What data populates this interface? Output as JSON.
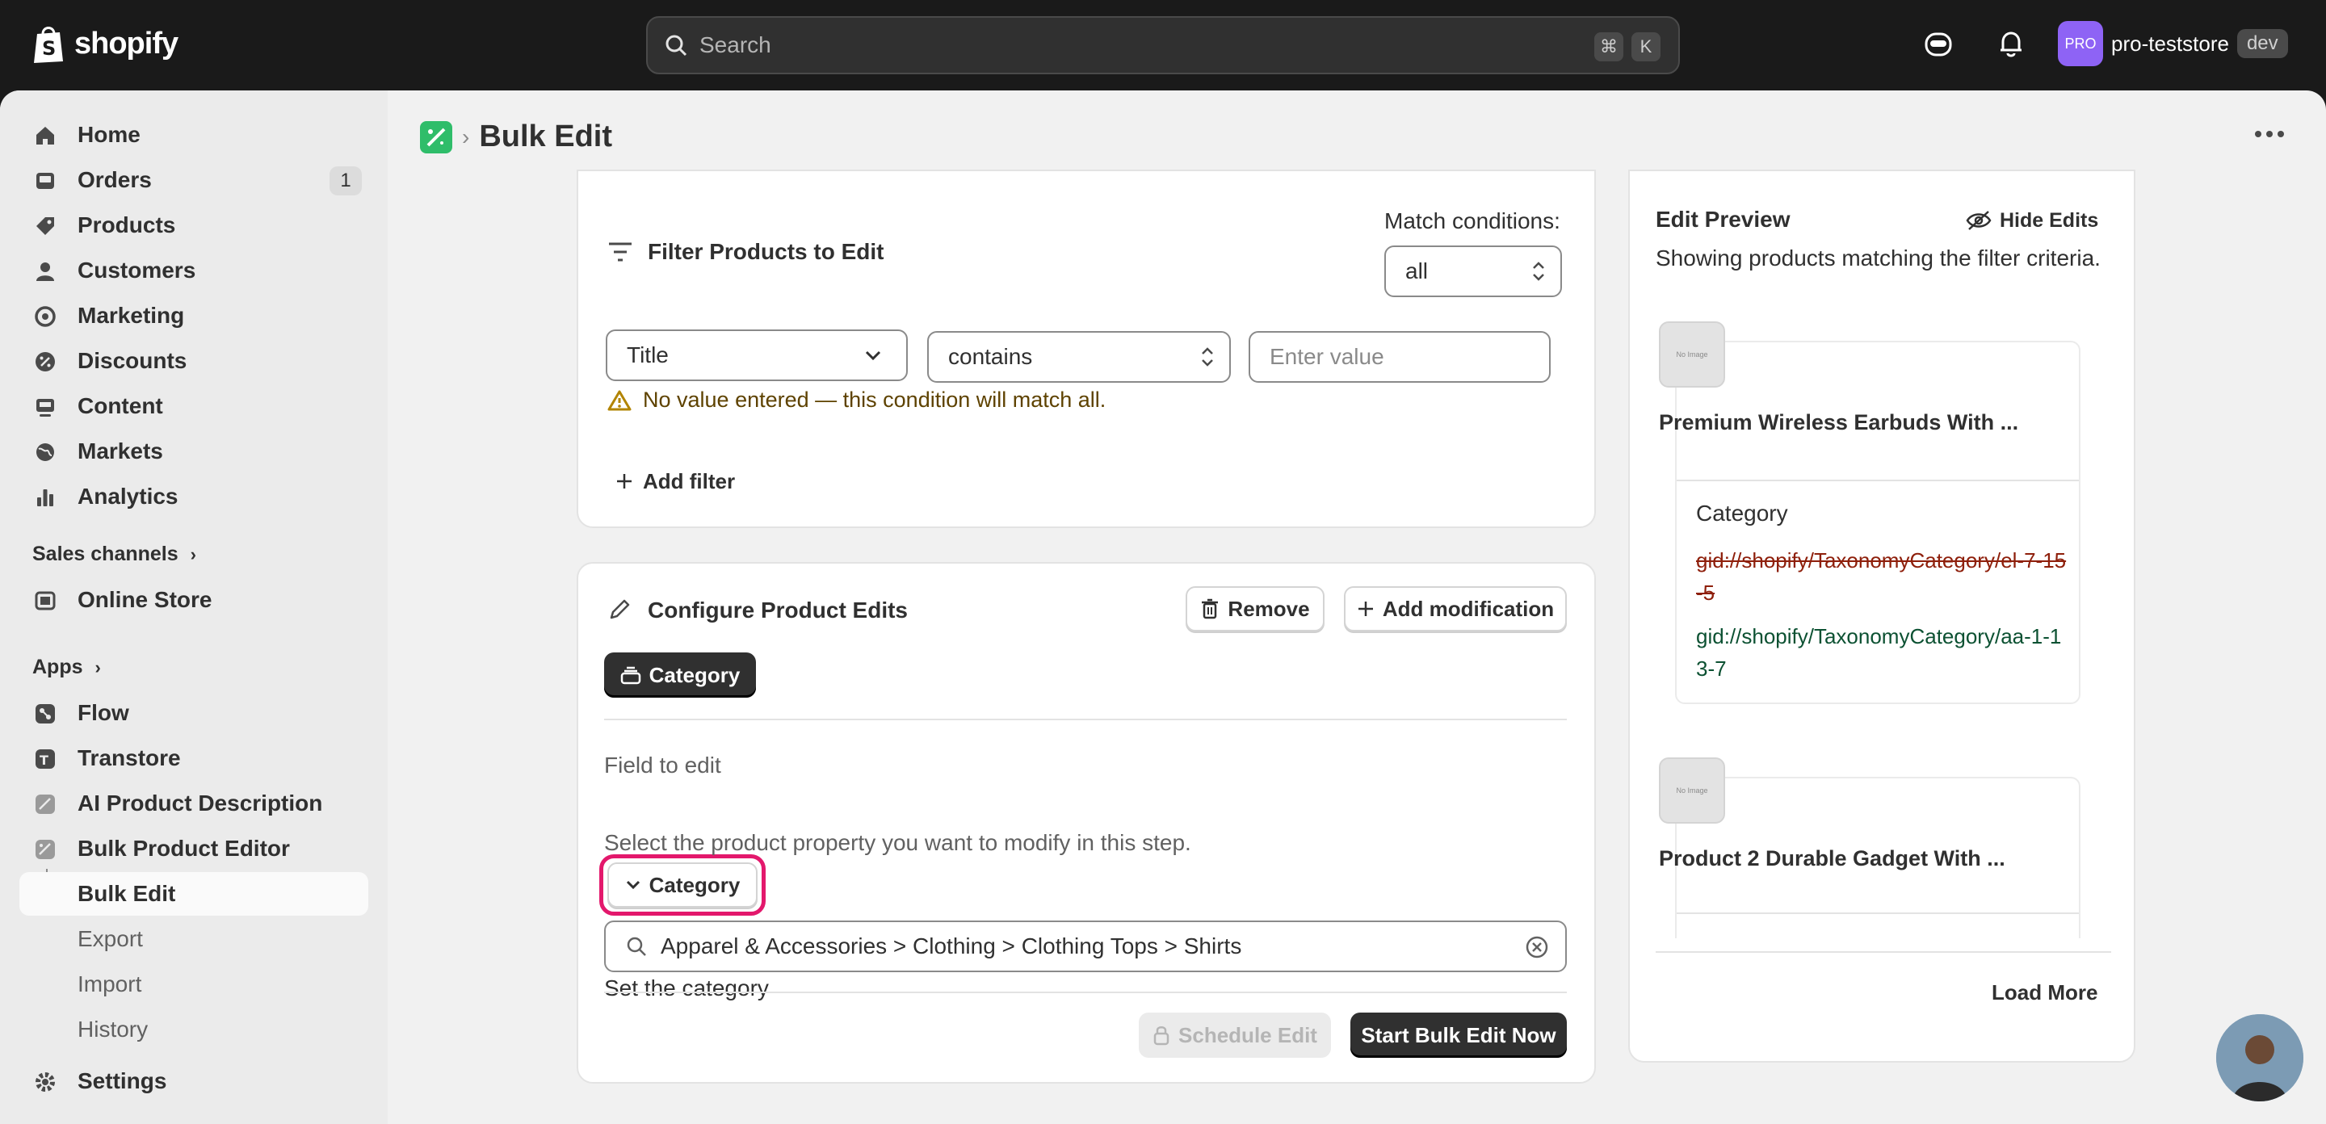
{
  "topbar": {
    "brand": "shopify",
    "search_placeholder": "Search",
    "shortcut_key1": "⌘",
    "shortcut_key2": "K",
    "store_avatar": "PRO",
    "store_name": "pro-teststore",
    "store_badge": "dev"
  },
  "sidebar": {
    "main": [
      {
        "label": "Home",
        "icon": "home-icon"
      },
      {
        "label": "Orders",
        "icon": "orders-icon",
        "count": "1"
      },
      {
        "label": "Products",
        "icon": "tag-icon"
      },
      {
        "label": "Customers",
        "icon": "person-icon"
      },
      {
        "label": "Marketing",
        "icon": "target-icon"
      },
      {
        "label": "Discounts",
        "icon": "discount-icon"
      },
      {
        "label": "Content",
        "icon": "content-icon"
      },
      {
        "label": "Markets",
        "icon": "globe-icon"
      },
      {
        "label": "Analytics",
        "icon": "chart-bar-icon"
      }
    ],
    "sales_channels_label": "Sales channels",
    "online_store": "Online Store",
    "apps_label": "Apps",
    "apps": [
      "Flow",
      "Transtore",
      "AI Product Description",
      "Bulk Product Editor"
    ],
    "bulk_sub": [
      "Bulk Edit",
      "Export",
      "Import",
      "History"
    ],
    "settings": "Settings"
  },
  "page": {
    "title": "Bulk Edit"
  },
  "filter_card": {
    "title": "Filter Products to Edit",
    "match_label": "Match conditions:",
    "match_value": "all",
    "field_value": "Title",
    "operator_value": "contains",
    "value_placeholder": "Enter value",
    "warning": "No value entered — this condition will match all.",
    "add_filter": "Add filter"
  },
  "edits_card": {
    "title": "Configure Product Edits",
    "remove": "Remove",
    "add_modification": "Add modification",
    "chip": "Category",
    "field_label": "Field to edit",
    "field_value": "Category",
    "field_help": "Select the product property you want to modify in this step.",
    "set_label": "Set the category",
    "set_value": "Apparel & Accessories > Clothing > Clothing Tops > Shirts",
    "schedule": "Schedule Edit",
    "start": "Start Bulk Edit Now"
  },
  "preview": {
    "title": "Edit Preview",
    "hide": "Hide Edits",
    "subtitle": "Showing products matching the filter criteria.",
    "thumb_text": "No Image",
    "products": [
      {
        "name": "Premium Wireless Earbuds With ...",
        "field": "Category",
        "old": "gid://shopify/TaxonomyCategory/el-7-15-5",
        "new": "gid://shopify/TaxonomyCategory/aa-1-13-7"
      },
      {
        "name": "Product 2 Durable Gadget With ..."
      }
    ],
    "load_more": "Load More"
  }
}
